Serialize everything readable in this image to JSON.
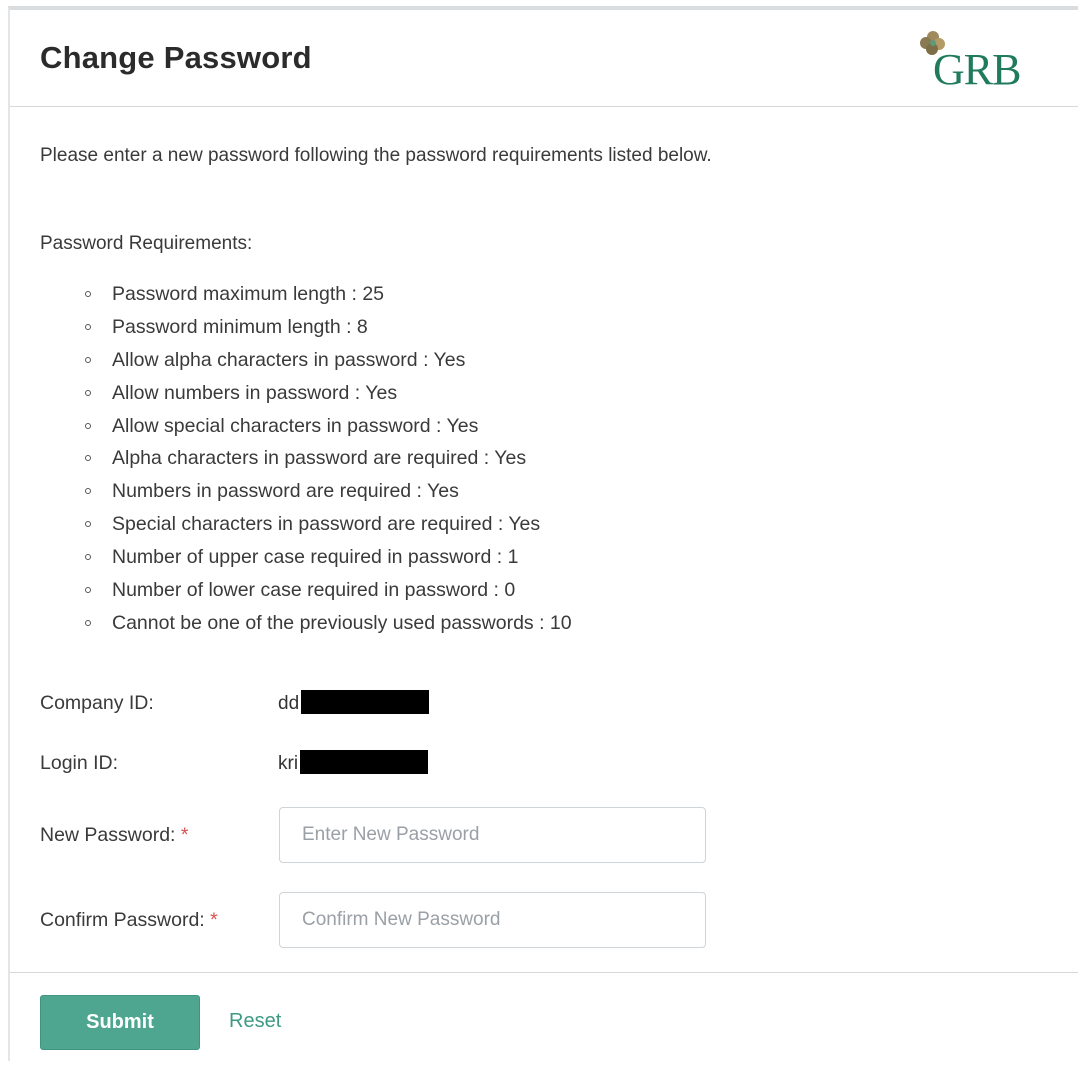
{
  "header": {
    "title": "Change Password",
    "logo_text": "GRB"
  },
  "intro": "Please enter a new password following the password requirements listed below.",
  "requirements": {
    "heading": "Password Requirements:",
    "items": [
      "Password maximum length : 25",
      "Password minimum length : 8",
      "Allow alpha characters in password : Yes",
      "Allow numbers in password : Yes",
      "Allow special characters in password : Yes",
      "Alpha characters in password are required : Yes",
      "Numbers in password are required : Yes",
      "Special characters in password are required : Yes",
      "Number of upper case required in password : 1",
      "Number of lower case required in password : 0",
      "Cannot be one of the previously used passwords : 10"
    ]
  },
  "form": {
    "company_id_label": "Company ID:",
    "company_id_value": "dd",
    "login_id_label": "Login ID:",
    "login_id_value": "kri",
    "new_password_label": "New Password:",
    "new_password_placeholder": "Enter New Password",
    "confirm_password_label": "Confirm Password:",
    "confirm_password_placeholder": "Confirm New Password",
    "required_marker": "*"
  },
  "actions": {
    "submit_label": "Submit",
    "reset_label": "Reset"
  },
  "colors": {
    "accent": "#4fa690",
    "link": "#3f9a83",
    "required": "#d9534f",
    "logo": "#1f7a5e"
  }
}
